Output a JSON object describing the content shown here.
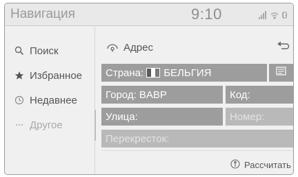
{
  "status": {
    "app_title": "Навигация",
    "clock": "9:10",
    "icons": [
      "signal-icon",
      "wifi-icon",
      "bluetooth-icon"
    ]
  },
  "sidebar": {
    "items": [
      {
        "label": "Поиск",
        "icon": "search-icon",
        "state": "normal"
      },
      {
        "label": "Избранное",
        "icon": "star-icon",
        "state": "normal"
      },
      {
        "label": "Недавнее",
        "icon": "clock-icon",
        "state": "normal"
      },
      {
        "label": "Другое",
        "icon": "more-icon",
        "state": "disabled"
      }
    ]
  },
  "main": {
    "header": {
      "label": "Адрес",
      "icon": "address-icon"
    },
    "back_icon": "back-icon",
    "country": {
      "label": "Страна:",
      "value": "БЕЛЬГИЯ",
      "flag_colors": [
        "#5a5a5a",
        "#ffffff",
        "#7a7a7a"
      ]
    },
    "country_list_icon": "list-icon",
    "city": {
      "label": "Город: BABP"
    },
    "code": {
      "label": "Код:"
    },
    "street": {
      "label": "Улица:"
    },
    "number": {
      "label": "Номер:"
    },
    "crossing": {
      "label": "Перекресток:"
    },
    "calculate": {
      "label": "Рассчитать",
      "icon": "route-icon"
    }
  },
  "colors": {
    "field_active": "#9d9d9d",
    "field_inactive": "#b9b9b9",
    "background": "#f0f0f0"
  }
}
